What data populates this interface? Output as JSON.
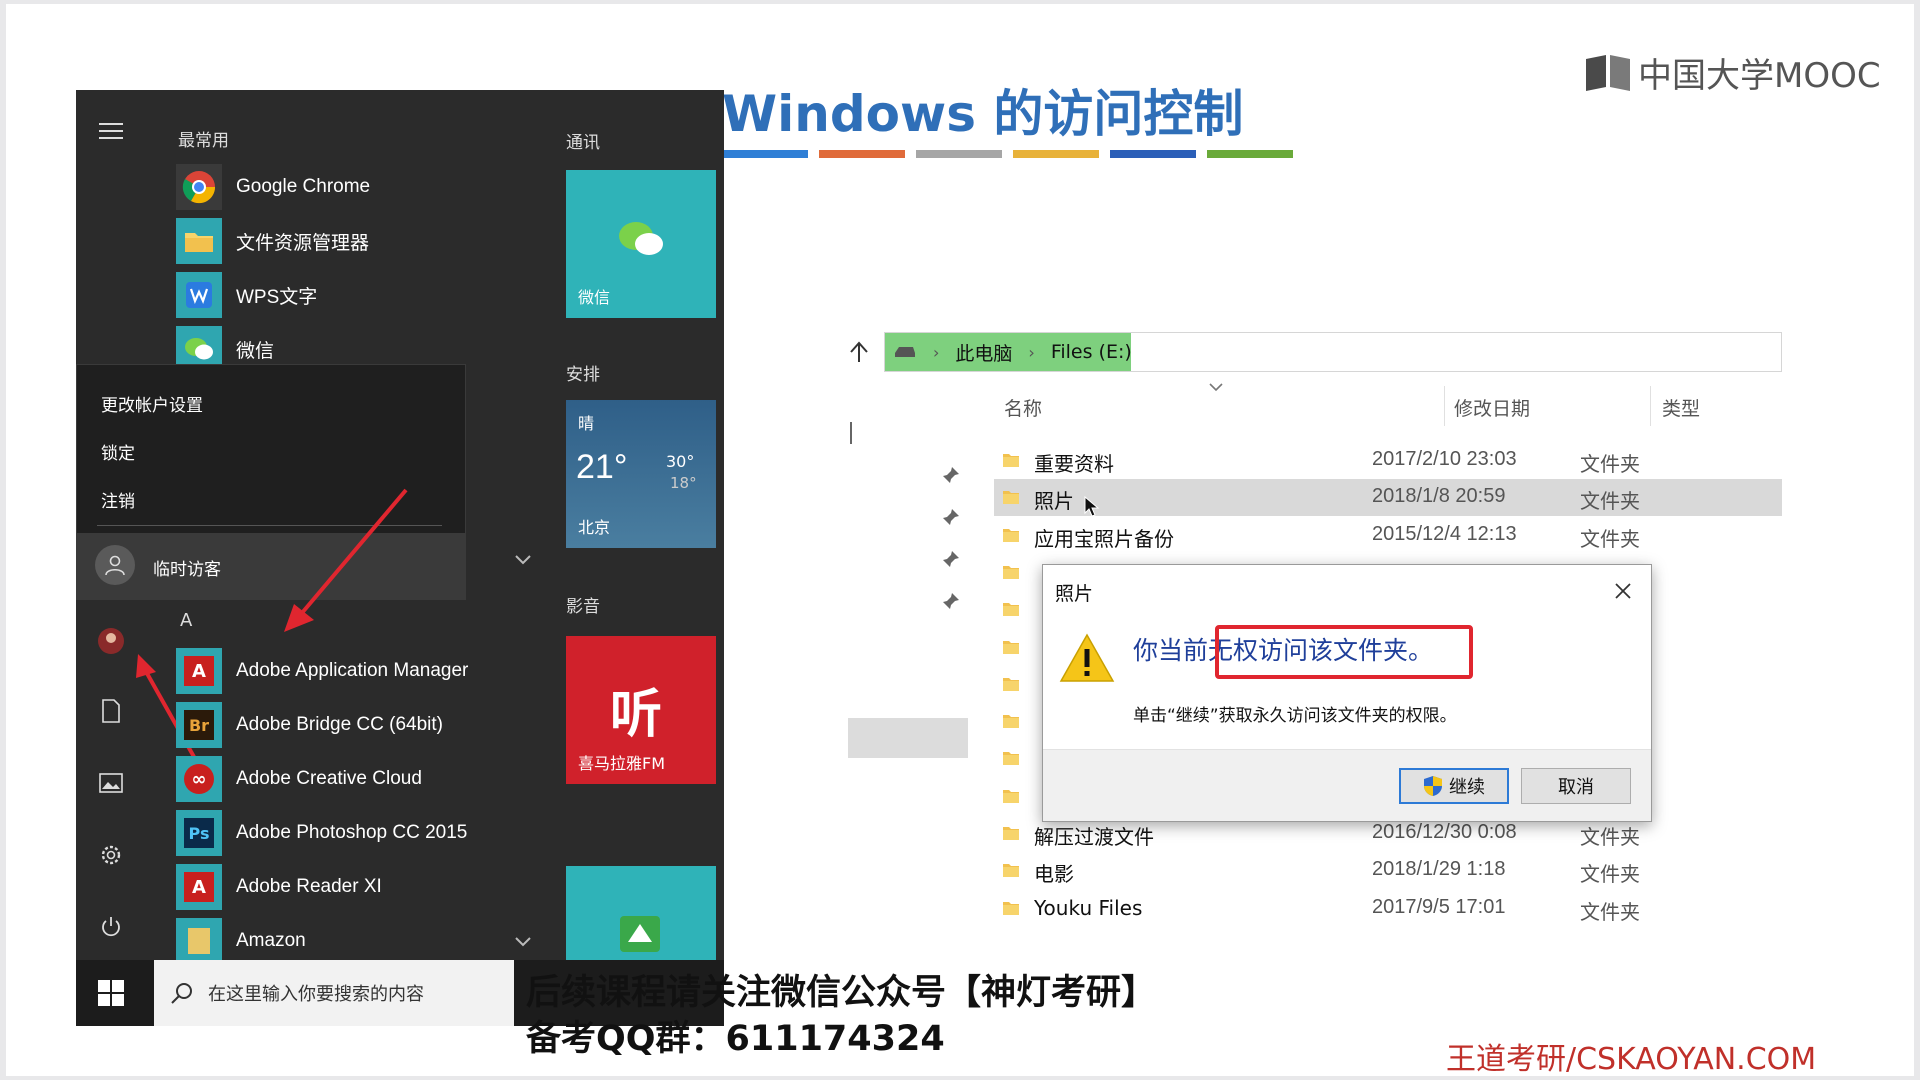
{
  "slide": {
    "title": "Windows 的访问控制",
    "logo_text": "中国大学MOOC",
    "watermark": "王道考研/CSKAOYAN.COM",
    "subtitle_line1": "后续课程请关注微信公众号【神灯考研】",
    "subtitle_line2": "备考QQ群：611174324",
    "bar_colors": [
      "#2f7fd6",
      "#e06b3a",
      "#a6a6a6",
      "#e8b23a",
      "#2b5fb8",
      "#6aaa3a"
    ]
  },
  "start_menu": {
    "most_used_label": "最常用",
    "most_used": [
      {
        "label": "Google Chrome",
        "icon": "chrome-icon"
      },
      {
        "label": "文件资源管理器",
        "icon": "folder-icon"
      },
      {
        "label": "WPS文字",
        "icon": "wps-icon"
      },
      {
        "label": "微信",
        "icon": "wechat-icon"
      }
    ],
    "account_menu": {
      "change_settings": "更改帐户设置",
      "lock": "锁定",
      "sign_out": "注销",
      "user_name": "临时访客"
    },
    "letter_a": "A",
    "apps": [
      {
        "label": "Adobe Application Manager",
        "icon_text": "A",
        "color": "#c8201e"
      },
      {
        "label": "Adobe Bridge CC (64bit)",
        "icon_text": "Br",
        "color": "#2b1a0a"
      },
      {
        "label": "Adobe Creative Cloud",
        "icon_text": "∞",
        "color": "#c8201e"
      },
      {
        "label": "Adobe Photoshop CC 2015",
        "icon_text": "Ps",
        "color": "#0a2a4a"
      },
      {
        "label": "Adobe Reader XI",
        "icon_text": "A",
        "color": "#c8201e"
      },
      {
        "label": "Amazon",
        "icon_text": "",
        "color": "#e8c76a"
      }
    ],
    "groups": {
      "communication": "通讯",
      "schedule": "安排",
      "media": "影音"
    },
    "tiles": {
      "wechat": "微信",
      "weather_condition": "晴",
      "weather_temp": "21°",
      "weather_high": "30°",
      "weather_low": "18°",
      "weather_city": "北京",
      "ximalaya": "喜马拉雅FM",
      "ximalaya_glyph": "听"
    },
    "search_placeholder": "在这里输入你要搜索的内容"
  },
  "explorer": {
    "breadcrumb": [
      "此电脑",
      "Files (E:)"
    ],
    "columns": {
      "name": "名称",
      "date": "修改日期",
      "type": "类型"
    },
    "files": [
      {
        "name": "重要资料",
        "date": "2017/2/10 23:03",
        "type": "文件夹"
      },
      {
        "name": "照片",
        "date": "2018/1/8 20:59",
        "type": "文件夹"
      },
      {
        "name": "应用宝照片备份",
        "date": "2015/12/4 12:13",
        "type": "文件夹"
      },
      {
        "name": "",
        "date": "",
        "type": "文件夹"
      },
      {
        "name": "",
        "date": "",
        "type": "文件夹"
      },
      {
        "name": "",
        "date": "",
        "type": "文件夹"
      },
      {
        "name": "",
        "date": "",
        "type": "文件夹"
      },
      {
        "name": "",
        "date": "",
        "type": "文件夹"
      },
      {
        "name": "",
        "date": "",
        "type": "文件夹"
      },
      {
        "name": "",
        "date": "",
        "type": "文件夹"
      },
      {
        "name": "解压过渡文件",
        "date": "2016/12/30 0:08",
        "type": "文件夹"
      },
      {
        "name": "电影",
        "date": "2018/1/29 1:18",
        "type": "文件夹"
      },
      {
        "name": "Youku Files",
        "date": "2017/9/5 17:01",
        "type": "文件夹"
      }
    ]
  },
  "dialog": {
    "title": "照片",
    "message": "你当前无权访问该文件夹。",
    "detail": "单击“继续”获取永久访问该文件夹的权限。",
    "continue_label": "继续",
    "cancel_label": "取消"
  }
}
